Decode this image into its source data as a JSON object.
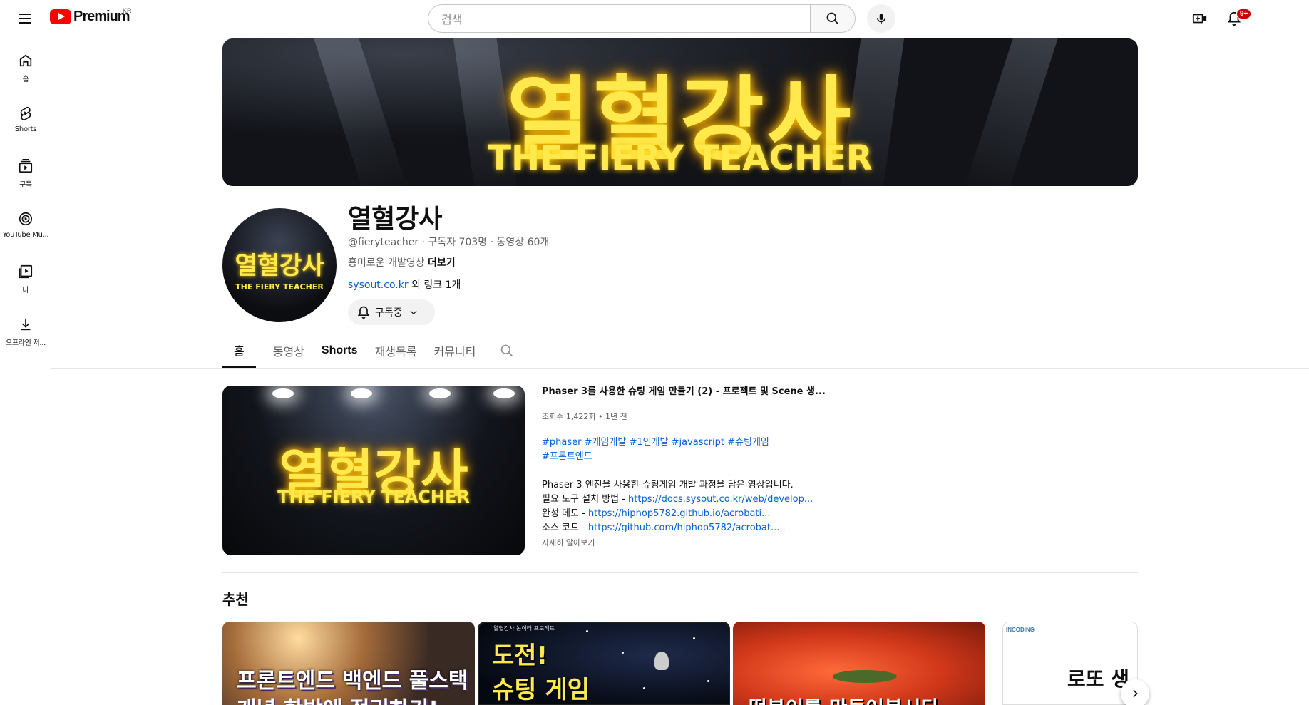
{
  "topbar": {
    "logo_text": "Premium",
    "logo_country": "KR",
    "search_placeholder": "검색",
    "notification_count": "9+"
  },
  "sidenav": {
    "items": [
      {
        "label": "홈",
        "icon": "home-icon"
      },
      {
        "label": "Shorts",
        "icon": "shorts-icon"
      },
      {
        "label": "구독",
        "icon": "subscriptions-icon"
      },
      {
        "label": "YouTube Mu...",
        "icon": "youtube-music-icon"
      },
      {
        "label": "나",
        "icon": "you-icon"
      },
      {
        "label": "오프라인 저...",
        "icon": "download-icon"
      }
    ]
  },
  "banner": {
    "title": "열혈강사",
    "subtitle": "THE FIERY TEACHER"
  },
  "channel": {
    "avatar_title": "열혈강사",
    "avatar_subtitle": "THE FIERY TEACHER",
    "name": "열혈강사",
    "meta": "@fieryteacher · 구독자 703명 · 동영상 60개",
    "description": "흥미로운 개발영상 ",
    "more_label": "더보기",
    "link": "sysout.co.kr",
    "link_suffix": " 외 링크 1개",
    "subscribe_label": "구독중"
  },
  "tabs": [
    {
      "label": "홈",
      "active": true
    },
    {
      "label": "동영상",
      "active": false
    },
    {
      "label": "Shorts",
      "active": false
    },
    {
      "label": "재생목록",
      "active": false
    },
    {
      "label": "커뮤니티",
      "active": false
    }
  ],
  "featured": {
    "thumb_title": "열혈강사",
    "thumb_subtitle": "THE FIERY TEACHER",
    "title": "Phaser 3를 사용한 슈팅 게임 만들기 (2) - 프로젝트 및 Scene 생...",
    "stats": "조회수 1,422회 • 1년 전",
    "tags_line1": "#phaser #게임개발 #1인개발 #javascript #슈팅게임",
    "tags_line2": "#프론트엔드",
    "desc_line1": "Phaser 3 엔진을 사용한 슈팅게임 개발 과정을 담은 영상입니다.",
    "desc_line2_label": "필요 도구 설치 방법 - ",
    "desc_line2_link": "https://docs.sysout.co.kr/web/develop...",
    "desc_line3_label": "완성 데모 - ",
    "desc_line3_link": "https://hiphop5782.github.io/acrobati...",
    "desc_line4_label": "소스 코드 - ",
    "desc_line4_link": "https://github.com/hiphop5782/acrobat.....",
    "more": "자세히 알아보기"
  },
  "recommended": {
    "title": "추천",
    "cards": [
      {
        "line1": "프론트엔드 백엔드 풀스택",
        "line2": "개념 한방에 정리하기!"
      },
      {
        "small": "열혈강사 논이터 프로젝트",
        "line1": "도전!",
        "line2": "슈팅 게임"
      },
      {
        "line1": "떡볶이를 만들어봅시다"
      },
      {
        "brand": "INCODING",
        "line1": "로또 생"
      }
    ]
  }
}
